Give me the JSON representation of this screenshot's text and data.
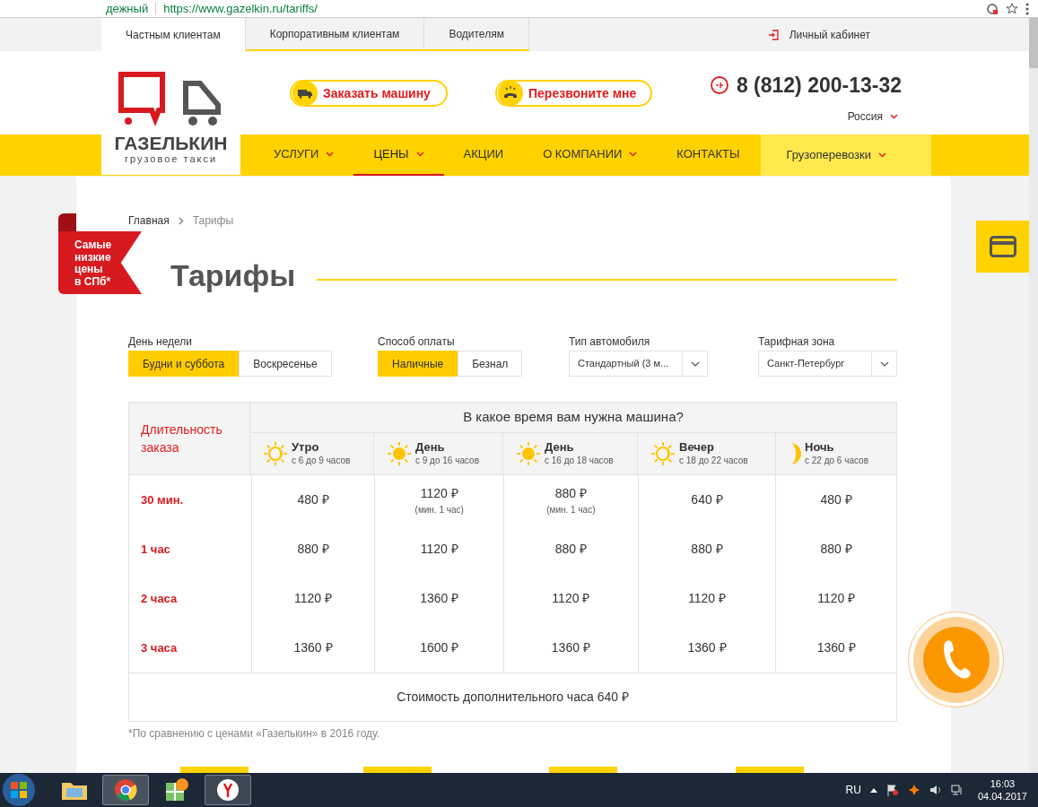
{
  "browser": {
    "security": "дежный",
    "url": "https://www.gazelkin.ru/tariffs/"
  },
  "top_tabs": [
    {
      "label": "Частным клиентам",
      "selected": true
    },
    {
      "label": "Корпоративным клиентам",
      "selected": false
    },
    {
      "label": "Водителям",
      "selected": false
    }
  ],
  "account_link": "Личный кабинет",
  "logo": {
    "name": "ГАЗЕЛЬКИН",
    "tagline": "грузовое такси"
  },
  "order_button": "Заказать машину",
  "callback_button": "Перезвоните мне",
  "phone": "8 (812) 200-13-32",
  "region": "Россия",
  "nav": [
    {
      "label": "УСЛУГИ",
      "dropdown": true,
      "selected": false
    },
    {
      "label": "ЦЕНЫ",
      "dropdown": true,
      "selected": true
    },
    {
      "label": "АКЦИИ",
      "dropdown": false,
      "selected": false
    },
    {
      "label": "О КОМПАНИИ",
      "dropdown": true,
      "selected": false
    },
    {
      "label": "КОНТАКТЫ",
      "dropdown": false,
      "selected": false
    }
  ],
  "nav_extra": "Грузоперевозки",
  "breadcrumb": [
    "Главная",
    "Тарифы"
  ],
  "ribbon": [
    "Самые",
    "низкие",
    "цены",
    "в СПб*"
  ],
  "title": "Тарифы",
  "filters": [
    {
      "label": "День недели",
      "kind": "toggle",
      "options": [
        {
          "label": "Будни и суббота",
          "selected": true
        },
        {
          "label": "Воскресенье",
          "selected": false
        }
      ]
    },
    {
      "label": "Способ оплаты",
      "kind": "toggle",
      "options": [
        {
          "label": "Наличные",
          "selected": true
        },
        {
          "label": "Безнал",
          "selected": false
        }
      ]
    },
    {
      "label": "Тип автомобиля",
      "kind": "select",
      "value": "Стандартный (3 м..."
    },
    {
      "label": "Тарифная зона",
      "kind": "select",
      "value": "Санкт-Петербург"
    }
  ],
  "table": {
    "corner": "Длительность заказа",
    "heading": "В какое время вам нужна машина?",
    "columns": [
      {
        "name": "Утро",
        "hours": "с 6 до 9 часов",
        "kind": "half-sun"
      },
      {
        "name": "День",
        "hours": "с 9 до 16 часов",
        "kind": "sun"
      },
      {
        "name": "День",
        "hours": "с 16 до 18 часов",
        "kind": "sun"
      },
      {
        "name": "Вечер",
        "hours": "с 18 до 22 часов",
        "kind": "half-sun"
      },
      {
        "name": "Ночь",
        "hours": "с 22 до 6 часов",
        "kind": "moon"
      }
    ],
    "rows": [
      {
        "duration": "30 мин.",
        "cells": [
          {
            "price": "480 ₽"
          },
          {
            "price": "1120 ₽",
            "note": "(мин. 1 час)"
          },
          {
            "price": "880 ₽",
            "note": "(мин. 1 час)"
          },
          {
            "price": "640 ₽"
          },
          {
            "price": "480 ₽"
          }
        ]
      },
      {
        "duration": "1 час",
        "cells": [
          {
            "price": "880 ₽"
          },
          {
            "price": "1120 ₽"
          },
          {
            "price": "880 ₽"
          },
          {
            "price": "880 ₽"
          },
          {
            "price": "880 ₽"
          }
        ]
      },
      {
        "duration": "2 часа",
        "cells": [
          {
            "price": "1120 ₽"
          },
          {
            "price": "1360 ₽"
          },
          {
            "price": "1120 ₽"
          },
          {
            "price": "1120 ₽"
          },
          {
            "price": "1120 ₽"
          }
        ]
      },
      {
        "duration": "3 часа",
        "cells": [
          {
            "price": "1360 ₽"
          },
          {
            "price": "1600 ₽"
          },
          {
            "price": "1360 ₽"
          },
          {
            "price": "1360 ₽"
          },
          {
            "price": "1360 ₽"
          }
        ]
      }
    ],
    "footer": "Стоимость дополнительного часа 640 ₽"
  },
  "footnote": "*По сравнению с ценами «Газелькин» в 2016 году.",
  "taskbar": {
    "language": "RU",
    "time": "16:03",
    "date": "04.04.2017"
  }
}
